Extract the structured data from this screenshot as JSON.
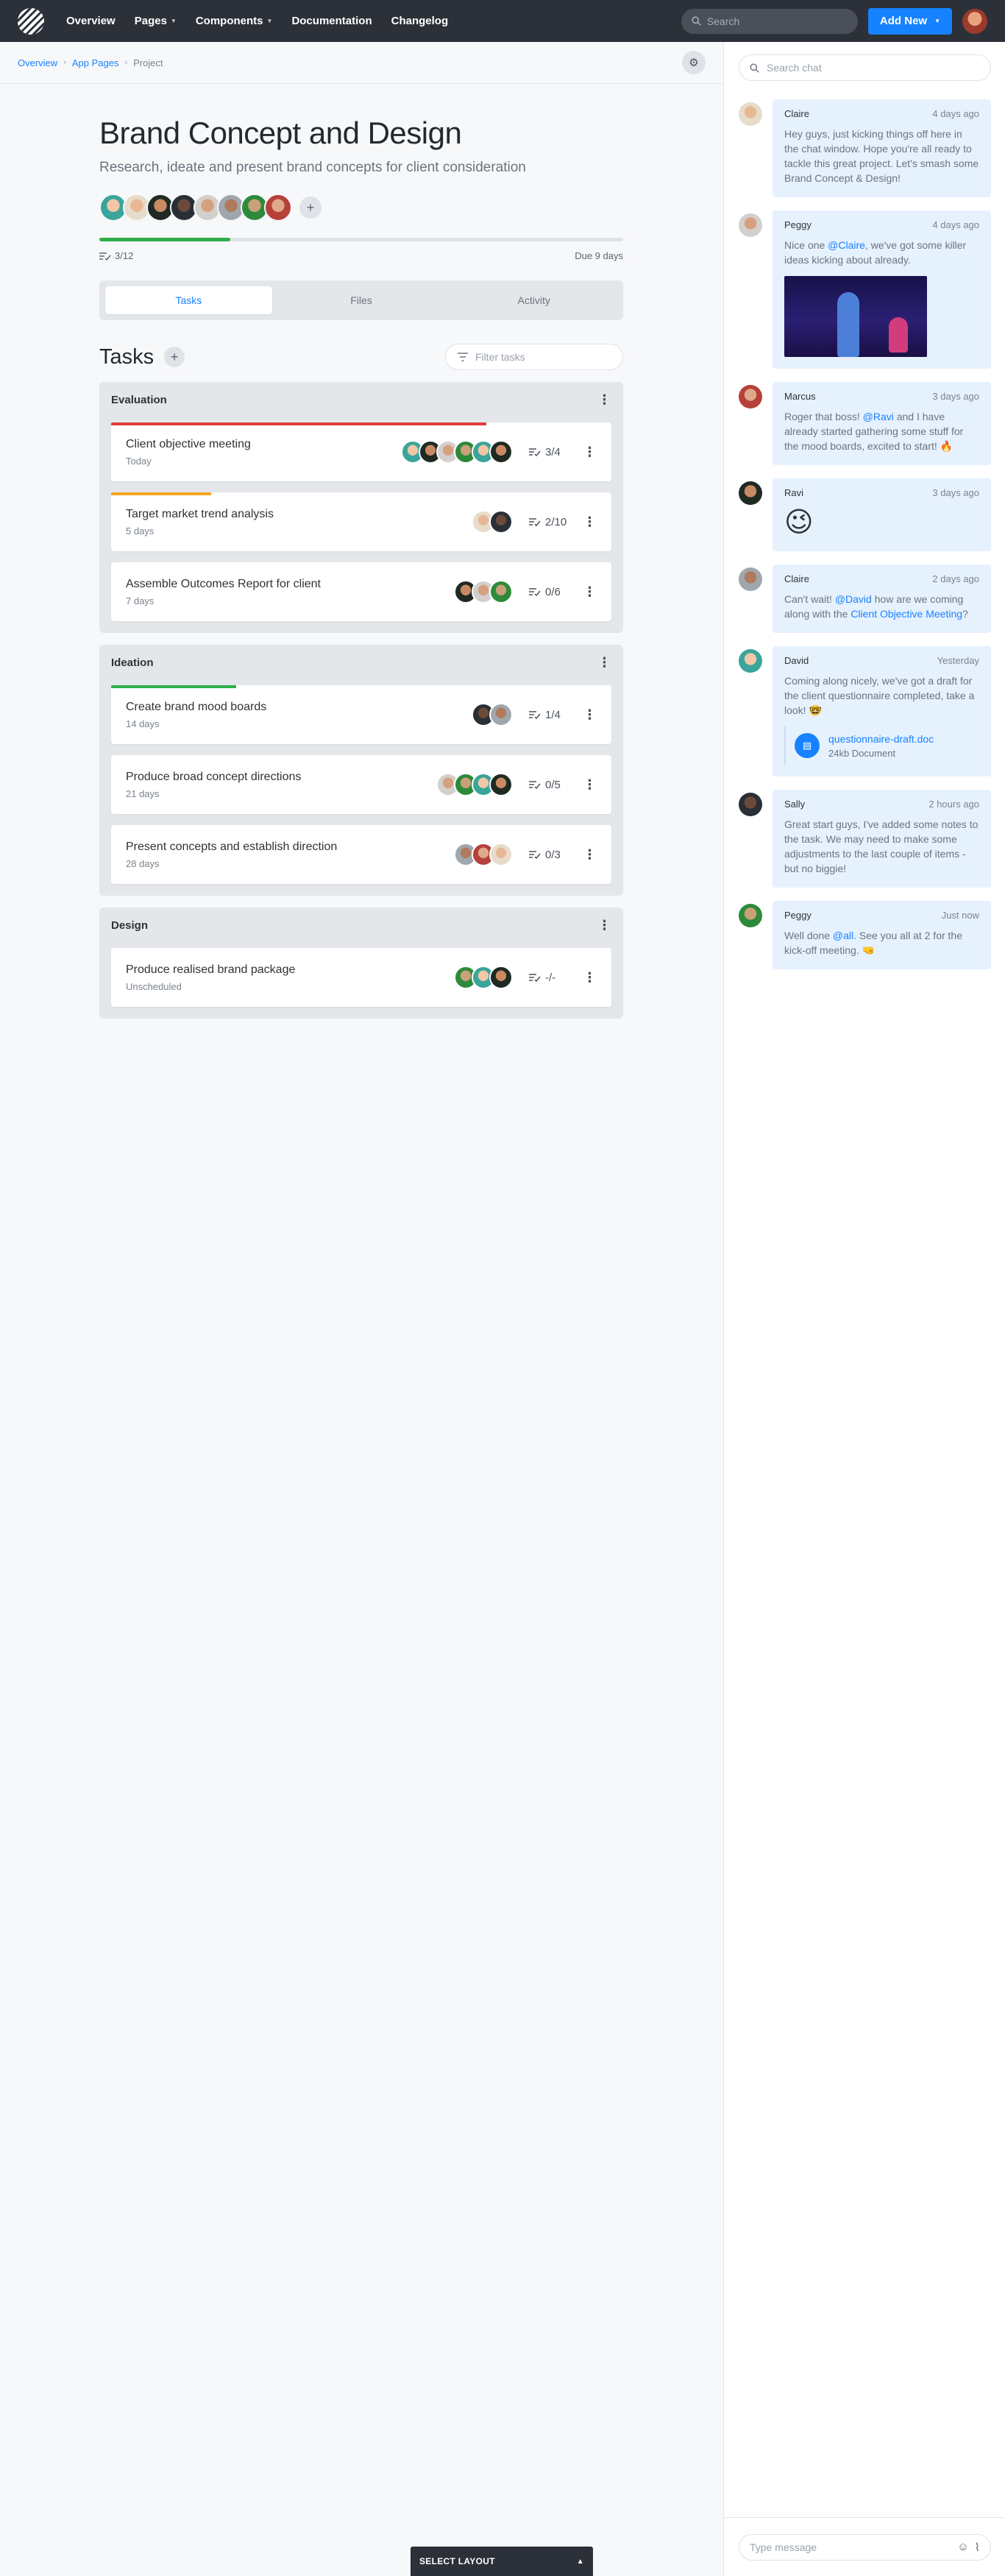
{
  "nav": {
    "links": [
      "Overview",
      "Pages",
      "Components",
      "Documentation",
      "Changelog"
    ],
    "search_placeholder": "Search",
    "add_new_label": "Add New"
  },
  "breadcrumb": [
    "Overview",
    "App Pages",
    "Project"
  ],
  "project": {
    "title": "Brand Concept and Design",
    "subtitle": "Research, ideate and present brand concepts for client consideration",
    "team_count": 8,
    "progress_text": "3/12",
    "progress_fraction": 0.25,
    "due_text": "Due 9 days"
  },
  "tabs": [
    "Tasks",
    "Files",
    "Activity"
  ],
  "active_tab": "Tasks",
  "tasks_title": "Tasks",
  "filter_placeholder": "Filter tasks",
  "groups": [
    {
      "name": "Evaluation",
      "tasks": [
        {
          "name": "Client objective meeting",
          "sub": "Today",
          "count": "3/4",
          "bar_color": "#e23b3b",
          "bar_fraction": 0.75,
          "avatars": 6
        },
        {
          "name": "Target market trend analysis",
          "sub": "5 days",
          "count": "2/10",
          "bar_color": "#f5a623",
          "bar_fraction": 0.2,
          "avatars": 2
        },
        {
          "name": "Assemble Outcomes Report for client",
          "sub": "7 days",
          "count": "0/6",
          "bar_color": "",
          "bar_fraction": 0,
          "avatars": 3
        }
      ]
    },
    {
      "name": "Ideation",
      "tasks": [
        {
          "name": "Create brand mood boards",
          "sub": "14 days",
          "count": "1/4",
          "bar_color": "#2dae4b",
          "bar_fraction": 0.25,
          "avatars": 2
        },
        {
          "name": "Produce broad concept directions",
          "sub": "21 days",
          "count": "0/5",
          "bar_color": "",
          "bar_fraction": 0,
          "avatars": 4
        },
        {
          "name": "Present concepts and establish direction",
          "sub": "28 days",
          "count": "0/3",
          "bar_color": "",
          "bar_fraction": 0,
          "avatars": 3
        }
      ]
    },
    {
      "name": "Design",
      "tasks": [
        {
          "name": "Produce realised brand package",
          "sub": "Unscheduled",
          "count": "-/-",
          "bar_color": "",
          "bar_fraction": 0,
          "avatars": 3
        }
      ]
    }
  ],
  "chat": {
    "search_placeholder": "Search chat",
    "input_placeholder": "Type message",
    "messages": [
      {
        "name": "Claire",
        "time": "4 days ago",
        "parts": [
          [
            "Hey guys, just kicking things off here in the chat window. Hope you're all ready to tackle this great project. Let's smash some Brand Concept & Design!",
            false
          ]
        ]
      },
      {
        "name": "Peggy",
        "time": "4 days ago",
        "parts": [
          [
            "Nice one ",
            false
          ],
          [
            "@Claire",
            true
          ],
          [
            ", we've got some killer ideas kicking about already.",
            false
          ]
        ],
        "gif": true
      },
      {
        "name": "Marcus",
        "time": "3 days ago",
        "parts": [
          [
            "Roger that boss! ",
            false
          ],
          [
            "@Ravi",
            true
          ],
          [
            " and I have already started gathering some stuff for the mood boards, excited to start! 🔥",
            false
          ]
        ]
      },
      {
        "name": "Ravi",
        "time": "3 days ago",
        "emoji": "😉"
      },
      {
        "name": "Claire",
        "time": "2 days ago",
        "parts": [
          [
            "Can't wait! ",
            false
          ],
          [
            "@David",
            true
          ],
          [
            " how are we coming along with the ",
            false
          ],
          [
            "Client Objective Meeting",
            true
          ],
          [
            "?",
            false
          ]
        ]
      },
      {
        "name": "David",
        "time": "Yesterday",
        "parts": [
          [
            "Coming along nicely, we've got a draft for the client questionnaire completed, take a look! 🤓",
            false
          ]
        ],
        "file": {
          "name": "questionnaire-draft.doc",
          "size": "24kb Document"
        }
      },
      {
        "name": "Sally",
        "time": "2 hours ago",
        "parts": [
          [
            "Great start guys, I've added some notes to the task. We may need to make some adjustments to the last couple of items - but no biggie!",
            false
          ]
        ]
      },
      {
        "name": "Peggy",
        "time": "Just now",
        "parts": [
          [
            "Well done ",
            false
          ],
          [
            "@all",
            true
          ],
          [
            ". See you all at 2 for the kick-off meeting. 🤜",
            false
          ]
        ]
      }
    ]
  },
  "select_layout_label": "SELECT LAYOUT",
  "colors": {
    "accent": "#1782ff",
    "progress": "#2dae4b",
    "navbar": "#2c3038"
  }
}
